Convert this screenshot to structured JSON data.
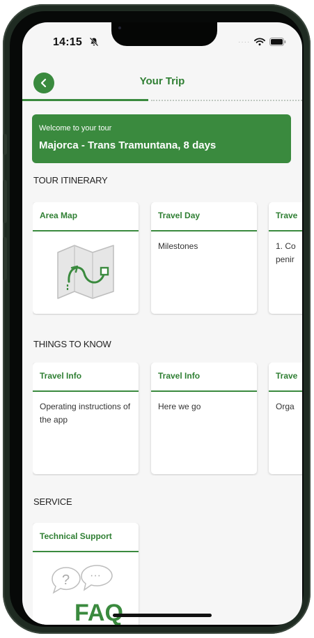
{
  "status": {
    "time": "14:15"
  },
  "header": {
    "title": "Your Trip"
  },
  "progress": {
    "fraction": 0.45
  },
  "banner": {
    "subtitle": "Welcome to your tour",
    "title": "Majorca - Trans Tramuntana, 8 days"
  },
  "itinerary": {
    "heading": "TOUR ITINERARY",
    "cards": [
      {
        "title": "Area Map",
        "body": "",
        "icon": "map-icon"
      },
      {
        "title": "Travel Day",
        "body": "Milestones"
      },
      {
        "title": "Trave",
        "body": "1. Co\npenir"
      }
    ]
  },
  "things": {
    "heading": "THINGS TO KNOW",
    "cards": [
      {
        "title": "Travel Info",
        "body": "Operating instructions of the app"
      },
      {
        "title": "Travel Info",
        "body": "Here we go"
      },
      {
        "title": "Trave",
        "body": "Orga"
      }
    ]
  },
  "service": {
    "heading": "SERVICE",
    "cards": [
      {
        "title": "Technical Support",
        "icon": "faq-icon",
        "icon_text": "FAQ",
        "bubble_q": "?",
        "bubble_dots": "···"
      }
    ]
  },
  "colors": {
    "accent": "#3a8a3e",
    "accent_text": "#2f7f33"
  }
}
